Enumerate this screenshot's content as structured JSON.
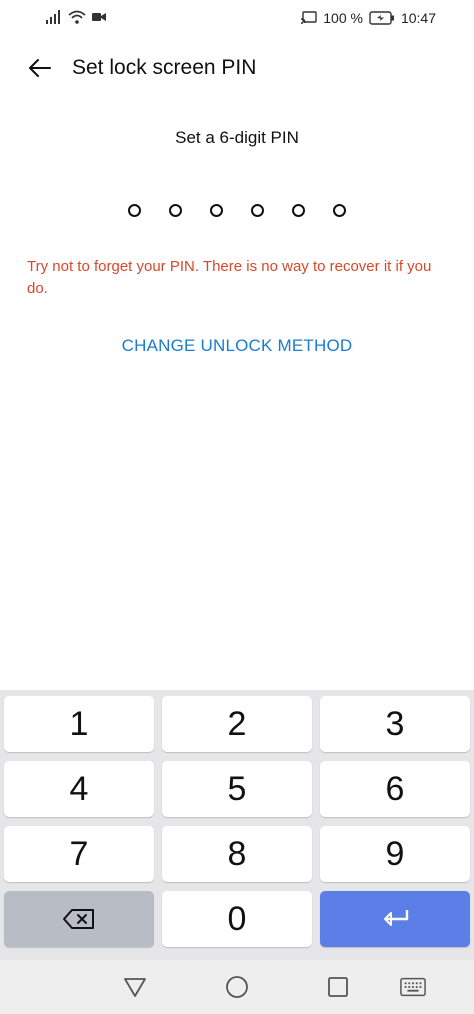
{
  "status_bar": {
    "battery_percent": "100 %",
    "time": "10:47"
  },
  "header": {
    "title": "Set lock screen PIN"
  },
  "prompt": "Set a 6-digit PIN",
  "pin": {
    "length": 6,
    "entered": 0
  },
  "warning": "Try not to forget your PIN. There is no way to recover it if you do.",
  "change_method_label": "CHANGE UNLOCK METHOD",
  "keypad": {
    "k1": "1",
    "k2": "2",
    "k3": "3",
    "k4": "4",
    "k5": "5",
    "k6": "6",
    "k7": "7",
    "k8": "8",
    "k9": "9",
    "k0": "0",
    "backspace_icon": "backspace-icon",
    "enter_icon": "enter-icon"
  },
  "colors": {
    "warning": "#d8472a",
    "link": "#1a7cd0",
    "enter_key": "#5b7fe6",
    "backspace_key": "#b8bcc5"
  }
}
